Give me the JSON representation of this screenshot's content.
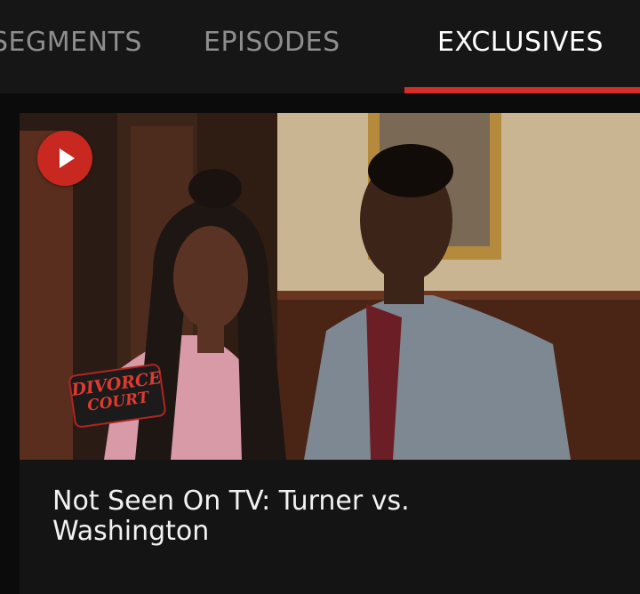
{
  "tabs": {
    "segments_label": "SEGMENTS",
    "episodes_label": "EPISODES",
    "exclusives_label": "EXCLUSIVES",
    "active": "EXCLUSIVES"
  },
  "video": {
    "title": "Not Seen On TV: Turner vs. Washington",
    "logo": {
      "line1": "DIVORCE",
      "line2": "COURT"
    }
  },
  "colors": {
    "accent": "#d32f27",
    "active_tab_text": "#ffffff",
    "inactive_tab_text": "#8e8e8e",
    "background": "#0b0b0b"
  }
}
